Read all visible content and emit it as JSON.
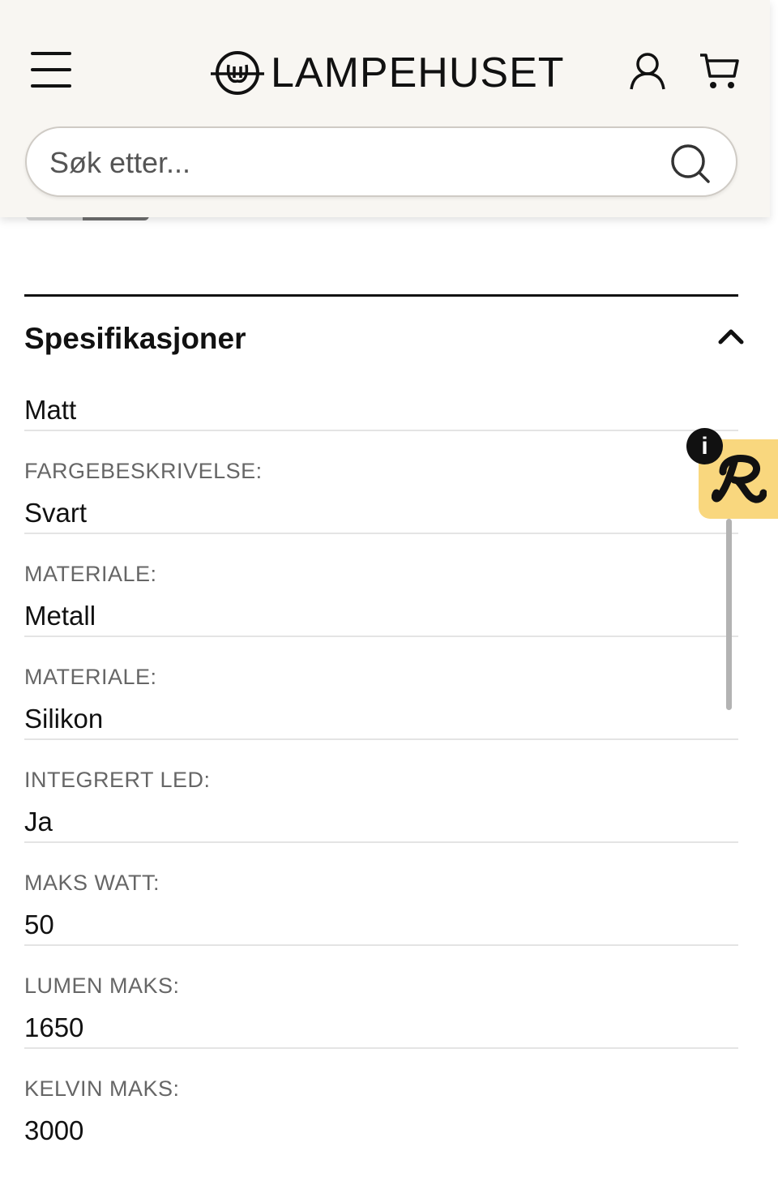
{
  "header": {
    "brand": "LAMPEHUSET",
    "icons": {
      "menu": "hamburger-menu-icon",
      "account": "user-icon",
      "cart": "shopping-cart-icon"
    }
  },
  "search": {
    "placeholder": "Søk etter...",
    "icon": "search-icon"
  },
  "specifications": {
    "title": "Spesifikasjoner",
    "expanded": true,
    "rows": [
      {
        "label": "",
        "value": "Matt"
      },
      {
        "label": "FARGEBESKRIVELSE:",
        "value": "Svart"
      },
      {
        "label": "MATERIALE:",
        "value": "Metall"
      },
      {
        "label": "MATERIALE:",
        "value": "Silikon"
      },
      {
        "label": "INTEGRERT LED:",
        "value": "Ja"
      },
      {
        "label": "MAKS WATT:",
        "value": "50"
      },
      {
        "label": "LUMEN MAKS:",
        "value": "1650"
      },
      {
        "label": "KELVIN MAKS:",
        "value": "3000"
      }
    ]
  },
  "review_widget": {
    "info_glyph": "i",
    "logo": "script-r-logo",
    "background": "#f9d77e"
  },
  "colors": {
    "header_bg": "#f8f6f2",
    "text": "#111111",
    "label": "#666666",
    "divider": "#e4e4e4"
  }
}
